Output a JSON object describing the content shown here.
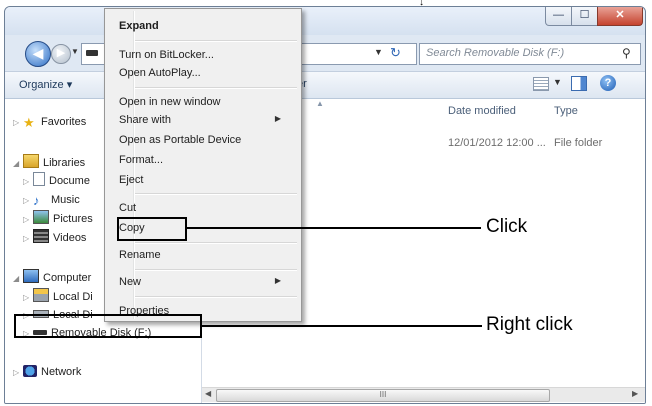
{
  "window": {
    "search_placeholder": "Search Removable Disk (F:)",
    "toolbar_organize": "Organize ▾",
    "toolbar_column_fragment": "er"
  },
  "nav_pane": {
    "items": [
      {
        "label": "Favorites",
        "icon": "star-icon"
      },
      {
        "label": "Libraries",
        "icon": "libraries-icon"
      },
      {
        "label": "Docume",
        "icon": "document-icon"
      },
      {
        "label": "Music",
        "icon": "music-icon"
      },
      {
        "label": "Pictures",
        "icon": "pictures-icon"
      },
      {
        "label": "Videos",
        "icon": "videos-icon"
      },
      {
        "label": "Computer",
        "icon": "computer-icon"
      },
      {
        "label": "Local Di",
        "icon": "local-disk-icon"
      },
      {
        "label": "Local Di",
        "icon": "local-disk-icon"
      },
      {
        "label": "Removable Disk (F:)",
        "icon": "removable-disk-icon"
      },
      {
        "label": "Network",
        "icon": "network-icon"
      }
    ]
  },
  "content": {
    "columns": {
      "date_modified": "Date modified",
      "type": "Type"
    },
    "rows": [
      {
        "date": "12/01/2012 12:00 ...",
        "type": "File folder"
      }
    ],
    "hscroll_thumb": "III"
  },
  "context_menu": {
    "items": [
      {
        "label": "Expand",
        "bold": true
      },
      {
        "label": "Turn on BitLocker..."
      },
      {
        "label": "Open AutoPlay..."
      },
      {
        "label": "Open in new window"
      },
      {
        "label": "Share with",
        "submenu": true
      },
      {
        "label": "Open as Portable Device"
      },
      {
        "label": "Format..."
      },
      {
        "label": "Eject"
      },
      {
        "label": "Cut"
      },
      {
        "label": "Copy"
      },
      {
        "label": "Rename"
      },
      {
        "label": "New",
        "submenu": true
      },
      {
        "label": "Properties"
      }
    ]
  },
  "annotations": {
    "click": "Click",
    "right_click": "Right click"
  }
}
